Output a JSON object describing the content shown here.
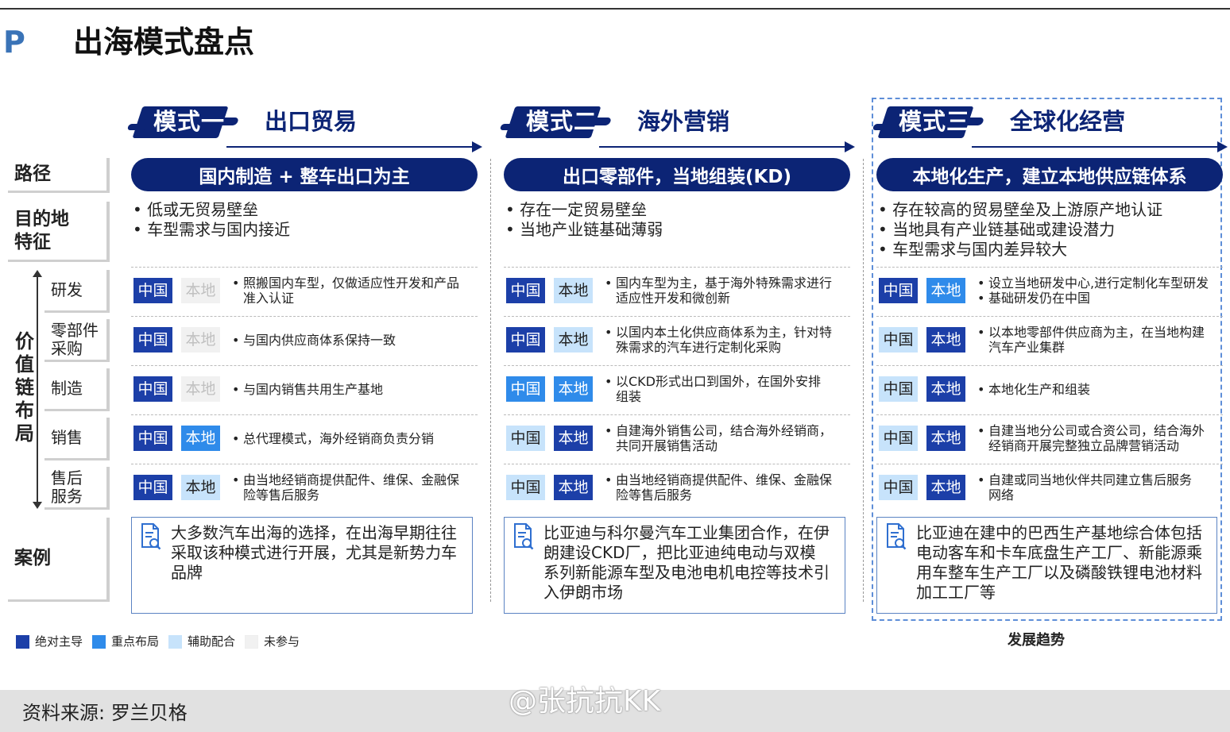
{
  "header": {
    "logo": "P",
    "title": "出海模式盘点"
  },
  "row_labels": {
    "path": "路径",
    "destination_l1": "目的地",
    "destination_l2": "特征",
    "value_chain": [
      "价",
      "值",
      "链",
      "布",
      "局"
    ],
    "case": "案例"
  },
  "stages": [
    {
      "line1": "研发",
      "line2": ""
    },
    {
      "line1": "零部件",
      "line2": "采购"
    },
    {
      "line1": "制造",
      "line2": ""
    },
    {
      "line1": "销售",
      "line2": ""
    },
    {
      "line1": "售后",
      "line2": "服务"
    }
  ],
  "badge_text": {
    "china": "中国",
    "local": "本地"
  },
  "modes": [
    {
      "label": "模式一",
      "name": "出口贸易",
      "path": "国内制造 + 整车出口为主",
      "features": [
        "低或无贸易壁垒",
        "车型需求与国内接近"
      ],
      "rows": [
        {
          "china": "abs",
          "local": "none",
          "text": [
            "照搬国内车型，仅做适应性开发和产品",
            "准入认证"
          ]
        },
        {
          "china": "abs",
          "local": "none",
          "text": [
            "与国内供应商体系保持一致"
          ]
        },
        {
          "china": "abs",
          "local": "none",
          "text": [
            "与国内销售共用生产基地"
          ]
        },
        {
          "china": "abs",
          "local": "key",
          "text": [
            "总代理模式，海外经销商负责分销"
          ]
        },
        {
          "china": "abs",
          "local": "aux",
          "text": [
            "由当地经销商提供配件、维保、金融保",
            "险等售后服务"
          ]
        }
      ],
      "case": [
        "大多数汽车出海的选择，在出海早期往往",
        "采取该种模式进行开展，尤其是新势力车",
        "品牌"
      ]
    },
    {
      "label": "模式二",
      "name": "海外营销",
      "path": "出口零部件，当地组装(KD)",
      "features": [
        "存在一定贸易壁垒",
        "当地产业链基础薄弱"
      ],
      "rows": [
        {
          "china": "abs",
          "local": "aux",
          "text": [
            "国内车型为主，基于海外特殊需求进行",
            "适应性开发和微创新"
          ]
        },
        {
          "china": "abs",
          "local": "aux",
          "text": [
            "以国内本土化供应商体系为主，针对特",
            "殊需求的汽车进行定制化采购"
          ]
        },
        {
          "china": "key",
          "local": "key",
          "text": [
            "以CKD形式出口到国外，在国外安排",
            "组装"
          ]
        },
        {
          "china": "aux",
          "local": "abs",
          "text": [
            "自建海外销售公司，结合海外经销商，",
            "共同开展销售活动"
          ]
        },
        {
          "china": "aux",
          "local": "abs",
          "text": [
            "由当地经销商提供配件、维保、金融保",
            "险等售后服务"
          ]
        }
      ],
      "case": [
        "比亚迪与科尔曼汽车工业集团合作，在伊",
        "朗建设CKD厂，把比亚迪纯电动与双模",
        "系列新能源车型及电池电机电控等技术引",
        "入伊朗市场"
      ]
    },
    {
      "label": "模式三",
      "name": "全球化经营",
      "path": "本地化生产，建立本地供应链体系",
      "features": [
        "存在较高的贸易壁垒及上游原产地认证",
        "当地具有产业链基础或建设潜力",
        "车型需求与国内差异较大"
      ],
      "rows": [
        {
          "china": "abs",
          "local": "key",
          "text": [
            "设立当地研发中心,进行定制化车型研发",
            "基础研发仍在中国"
          ],
          "multi": true
        },
        {
          "china": "aux",
          "local": "abs",
          "text": [
            "以本地零部件供应商为主，在当地构建",
            "汽车产业集群"
          ]
        },
        {
          "china": "aux",
          "local": "abs",
          "text": [
            "本地化生产和组装"
          ]
        },
        {
          "china": "aux",
          "local": "abs",
          "text": [
            "自建当地分公司或合资公司，结合海外",
            "经销商开展完整独立品牌营销活动"
          ]
        },
        {
          "china": "aux",
          "local": "abs",
          "text": [
            "自建或同当地伙伴共同建立售后服务",
            "网络"
          ]
        }
      ],
      "case": [
        "比亚迪在建中的巴西生产基地综合体包括",
        "电动客车和卡车底盘生产工厂、新能源乘",
        "用车整车生产工厂以及磷酸铁锂电池材料",
        "加工工厂等"
      ]
    }
  ],
  "legend": [
    {
      "key": "abs",
      "label": "绝对主导",
      "color": "#1c3fa8"
    },
    {
      "key": "key",
      "label": "重点布局",
      "color": "#2f8bea"
    },
    {
      "key": "aux",
      "label": "辅助配合",
      "color": "#c7e3fb"
    },
    {
      "key": "none",
      "label": "未参与",
      "color": "#f1f1f1"
    }
  ],
  "trend_label": "发展趋势",
  "footer": {
    "source": "资料来源: 罗兰贝格",
    "watermark": "@张抗抗KK"
  }
}
